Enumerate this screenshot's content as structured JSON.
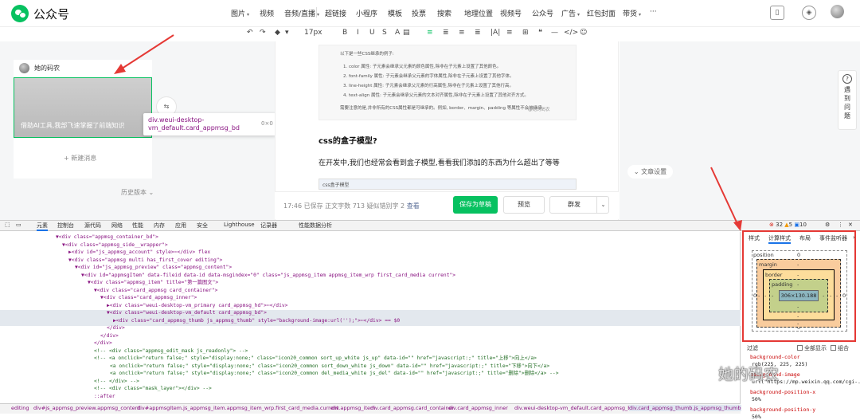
{
  "app": {
    "logo_text": "公众号"
  },
  "topnav": {
    "items": [
      {
        "label": "图片",
        "dd": true
      },
      {
        "label": "视频",
        "dd": false
      },
      {
        "label": "音频/直播",
        "dd": true
      },
      {
        "label": "超链接",
        "dd": false
      },
      {
        "label": "小程序",
        "dd": false
      },
      {
        "label": "模板",
        "dd": false
      },
      {
        "label": "投票",
        "dd": false
      },
      {
        "label": "搜索",
        "dd": false
      },
      {
        "label": "地理位置",
        "dd": false
      },
      {
        "label": "视频号",
        "dd": false
      },
      {
        "label": "公众号",
        "dd": false
      },
      {
        "label": "广告",
        "dd": true
      },
      {
        "label": "红包封面",
        "dd": false
      },
      {
        "label": "带货",
        "dd": true
      },
      {
        "label": "···",
        "dd": false
      }
    ]
  },
  "editor_toolbar": {
    "font_size": "17px",
    "items": [
      "↶",
      "↷",
      "◆",
      "▾",
      "B",
      "I",
      "U",
      "S",
      "A",
      "▤",
      "≡",
      "≣",
      "≡",
      "≣",
      "|A|",
      "≡",
      "⊞",
      "❝",
      "—",
      "</>",
      "☺"
    ]
  },
  "left_panel": {
    "account_name": "她的码农",
    "thumb_title": "借助AI工具,我部飞速掌握了前端知识",
    "new_message": "+ 新建消息",
    "history": "历史版本 ⌄",
    "tooltip": {
      "selector": "div.weui-desktop-vm_default.card_appmsg_bd",
      "size": "0×0"
    }
  },
  "article": {
    "code_lines": [
      "以下是一些CSS继承的例子:",
      "1. color 属性: 子元素会继承父元素的颜色属性,除非在子元素上设置了其他颜色。",
      "2. font-family 属性: 子元素会继承父元素的字体属性,除非在子元素上设置了其他字体。",
      "3. line-height 属性: 子元素会继承父元素的行高属性,除非在子元素上设置了其他行高。",
      "4. text-align 属性: 子元素会继承父元素的文本对齐属性,除非在子元素上设置了其他对齐方式。",
      "需要注意的是,并非所有的CSS属性都是可继承的。例如, border、margin、padding 等属性不会被继承。"
    ],
    "image_caption": "@她的码农",
    "heading": "css的盒子模型?",
    "paragraph": "在开发中,我们也经常会看到盒子模型,看看我们添加的东西为什么超出了等等",
    "small_image_caption": "css盒子模型"
  },
  "bottom_bar": {
    "time": "17:46",
    "saved": "已保存",
    "wordcount": "正文字数 713",
    "suspect": "疑似错别字 2",
    "view": "查看",
    "save_draft": "保存为草稿",
    "preview": "预览",
    "publish": "群发"
  },
  "right_side": {
    "article_settings": "文章设置",
    "help": [
      "遇",
      "到",
      "问",
      "题"
    ]
  },
  "devtools": {
    "tabs": [
      "元素",
      "控制台",
      "源代码",
      "网络",
      "性能",
      "内存",
      "应用",
      "安全",
      "Lighthouse",
      "记录器",
      "性能数据分析"
    ],
    "errors": "32",
    "warnings": "5",
    "infos": "10",
    "code_lines": [
      {
        "indent": 70,
        "text": "▼<div class=\"appmsg_container_bd\">",
        "c": false
      },
      {
        "indent": 78,
        "text": "▼<div class=\"appmsg_side__wrapper\">",
        "c": false
      },
      {
        "indent": 86,
        "text": "▶<div id=\"js_appmsg_account\" style>⋯</div> flex",
        "c": false
      },
      {
        "indent": 86,
        "text": "▼<div class=\"appmsg multi has_first_cover editing\">",
        "c": false
      },
      {
        "indent": 94,
        "text": "▼<div id=\"js_appmsg_preview\" class=\"appmsg_content\">",
        "c": false
      },
      {
        "indent": 102,
        "text": "▼<div id=\"appmsgItem\" data-fileid data-id data-msgindex=\"0\" class=\"js_appmsg_item appmsg_item_wrp  first_card_media current\">",
        "c": false
      },
      {
        "indent": 110,
        "text": "▼<div class=\"appmsg_item\" title=\"第一篇图文\">",
        "c": false
      },
      {
        "indent": 118,
        "text": "▼<div class=\"card_appmsg card_container\">",
        "c": false
      },
      {
        "indent": 126,
        "text": "▼<div class=\"card_appmsg_inner\">",
        "c": false
      },
      {
        "indent": 134,
        "text": "▶<div class=\"weui-desktop-vm_primary card_appmsg_hd\">⋯</div>",
        "c": false
      },
      {
        "indent": 134,
        "text": "▼<div class=\"weui-desktop-vm_default card_appmsg_bd\">",
        "c": false
      },
      {
        "indent": 142,
        "text": "▶<div class=\"card_appmsg_thumb js_appmsg_thumb\" style=\"background-image:url('');\">⋯</div> == $0",
        "c": false
      },
      {
        "indent": 134,
        "text": "</div>",
        "c": false
      },
      {
        "indent": 126,
        "text": "</div>",
        "c": false
      },
      {
        "indent": 118,
        "text": "</div>",
        "c": false
      },
      {
        "indent": 118,
        "text": "<!-- <div class=\"appmsg_edit_mask js_readonly\"> -->",
        "c": true
      },
      {
        "indent": 118,
        "text": "<!-- <a onclick=\"return false;\" style=\"display:none;\" class=\"icon20_common sort_up_white  js_up\"  data-id=\"\" href=\"javascript:;\" title=\"上移\">向上</a>",
        "c": true
      },
      {
        "indent": 138,
        "text": "<a onclick=\"return false;\" style=\"display:none;\" class=\"icon20_common sort_down_white js_down\" data-id=\"\" href=\"javascript:;\" title=\"下移\">向下</a>",
        "c": true
      },
      {
        "indent": 138,
        "text": "<a onclick=\"return false;\" style=\"display:none;\" class=\"icon20_common del_media_white js_del\"  data-id=\"\" href=\"javascript:;\" title=\"删除\">删除</a> -->",
        "c": true
      },
      {
        "indent": 118,
        "text": "<!-- </div> -->",
        "c": true
      },
      {
        "indent": 118,
        "text": "<!-- <div class=\"mask_layer\"></div>  -->",
        "c": true
      },
      {
        "indent": 118,
        "text": "::after",
        "c": false
      }
    ],
    "breadcrumbs": [
      "editing",
      "div#js_appmsg_preview.appmsg_content",
      "div#appmsgItem.js_appmsg_item.appmsg_item_wrp.first_card_media.current",
      "div.appmsg_item",
      "div.card_appmsg.card_container",
      "div.card_appmsg_inner",
      "div.weui-desktop-vm_default.card_appmsg_bd",
      "div.card_appmsg_thumb.js_appmsg_thumb"
    ],
    "side_tabs": [
      "样式",
      "计算样式",
      "布局",
      "事件监听器"
    ],
    "box_model": {
      "position_label": "position",
      "position": "0",
      "margin_label": "margin",
      "margin": "-",
      "border_label": "border",
      "border": "-",
      "padding_label": "padding",
      "padding": "-",
      "content": "306×130.188",
      "side_zero": "0"
    },
    "filter": "过滤",
    "show_all": "全部显示",
    "group": "组合",
    "props": [
      {
        "name": "background-color",
        "value": "rgb(225, 225, 225)"
      },
      {
        "name": "background-image",
        "value": "url(\"https://mp.weixin.qq.com/cgi-..."
      },
      {
        "name": "background-position-x",
        "value": "50%"
      },
      {
        "name": "background-position-y",
        "value": "50%"
      }
    ],
    "watermark": "她的码农"
  }
}
